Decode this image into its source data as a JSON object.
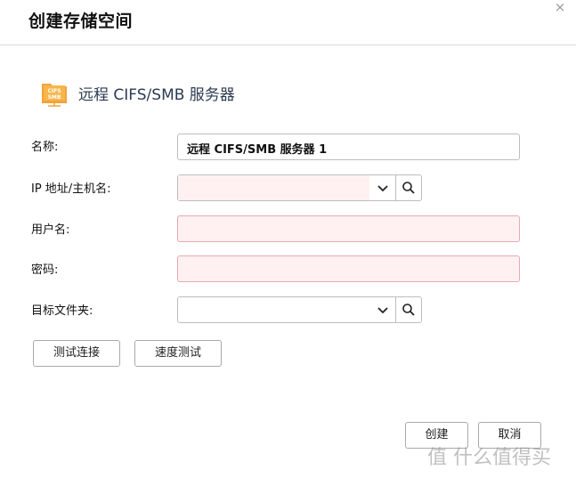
{
  "dialog": {
    "title": "创建存储空间",
    "close_icon": "×"
  },
  "server": {
    "icon_text_top": "CIFS",
    "icon_text_bottom": "SMB",
    "title": "远程 CIFS/SMB 服务器"
  },
  "form": {
    "name_label": "名称:",
    "name_value": "远程 CIFS/SMB 服务器 1",
    "host_label": "IP 地址/主机名:",
    "host_value": "",
    "username_label": "用户名:",
    "username_value": "",
    "password_label": "密码:",
    "password_value": "",
    "folder_label": "目标文件夹:",
    "folder_value": ""
  },
  "buttons": {
    "test_connection": "测试连接",
    "speed_test": "速度测试",
    "create": "创建",
    "cancel": "取消"
  },
  "watermark": "值 什么值得买",
  "colors": {
    "error_bg": "#fff1f2",
    "error_border": "#e7a9b1",
    "icon_orange": "#f2a33a"
  }
}
